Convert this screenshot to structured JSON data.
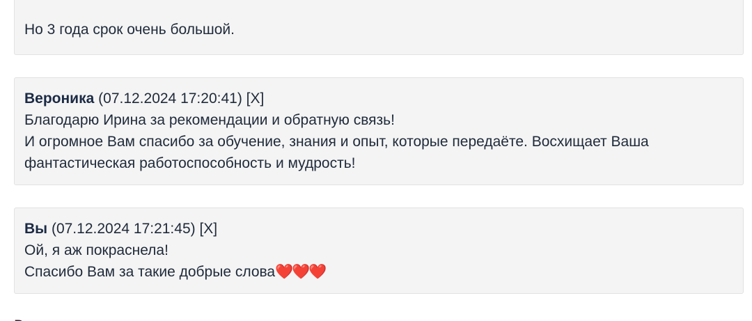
{
  "messages": [
    {
      "lines": [
        "Но 3 года срок очень большой."
      ]
    },
    {
      "author": "Вероника",
      "timestamp": "(07.12.2024 17:20:41)",
      "delete_label": "[X]",
      "lines": [
        "Благодарю Ирина за рекомендации и обратную связь!",
        "И огромное Вам спасибо за обучение, знания и опыт, которые передаёте. Восхищает Ваша",
        "фантастическая работоспособность и мудрость!"
      ]
    },
    {
      "author": "Вы",
      "timestamp": "(07.12.2024 17:21:45)",
      "delete_label": "[X]",
      "lines": [
        "Ой, я аж покраснела!",
        "Спасибо Вам за такие добрые слова"
      ],
      "emoji": "❤️❤️❤️"
    }
  ]
}
